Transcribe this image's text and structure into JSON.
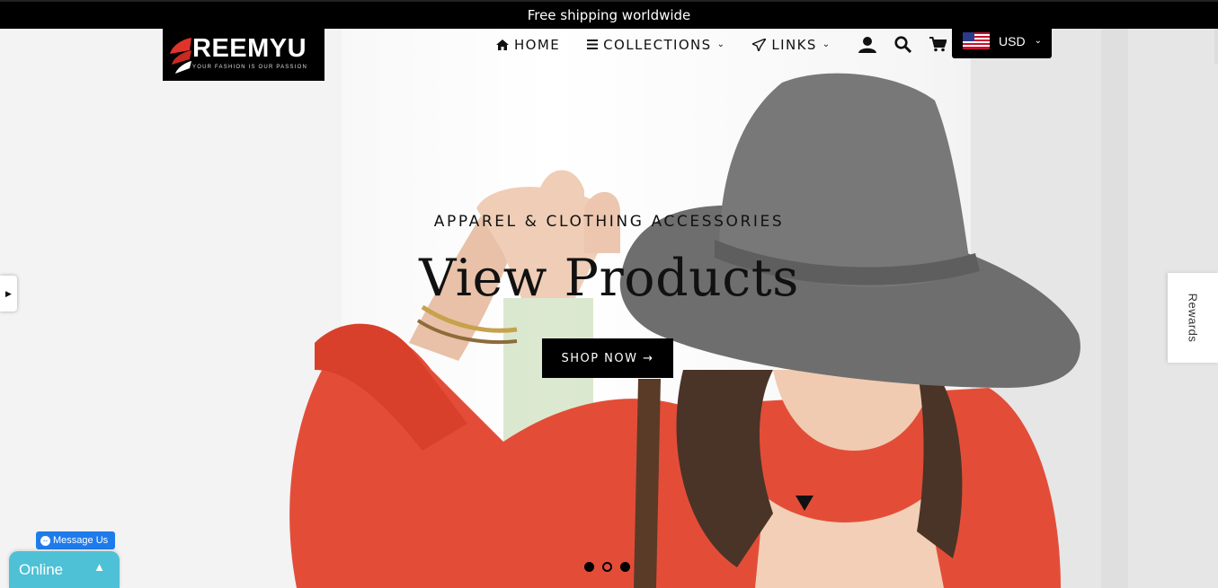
{
  "announcement": {
    "text": "Free shipping worldwide"
  },
  "logo": {
    "brand": "REEMYU",
    "tagline": "YOUR FASHION IS OUR PASSION"
  },
  "nav": {
    "items": [
      {
        "label": "HOME",
        "icon": "home-icon"
      },
      {
        "label": "COLLECTIONS",
        "icon": "menu-icon"
      },
      {
        "label": "LINKS",
        "icon": "paper-plane-icon"
      }
    ],
    "icons": [
      "account-icon",
      "search-icon",
      "cart-icon"
    ]
  },
  "currency": {
    "code": "USD",
    "flag": "us-flag-icon"
  },
  "hero": {
    "subtitle": "APPAREL & CLOTHING ACCESSORIES",
    "title": "View Products",
    "button": "SHOP NOW →",
    "slides": 3,
    "active_slide": 2
  },
  "rewards": {
    "label": "Rewards"
  },
  "messenger": {
    "label": "Message Us"
  },
  "chat": {
    "status": "Online"
  },
  "colors": {
    "accent": "#000000",
    "chat": "#4ec1d6",
    "messenger": "#1f7bea",
    "shirt": "#e34d38",
    "hat": "#6e6e6e"
  }
}
